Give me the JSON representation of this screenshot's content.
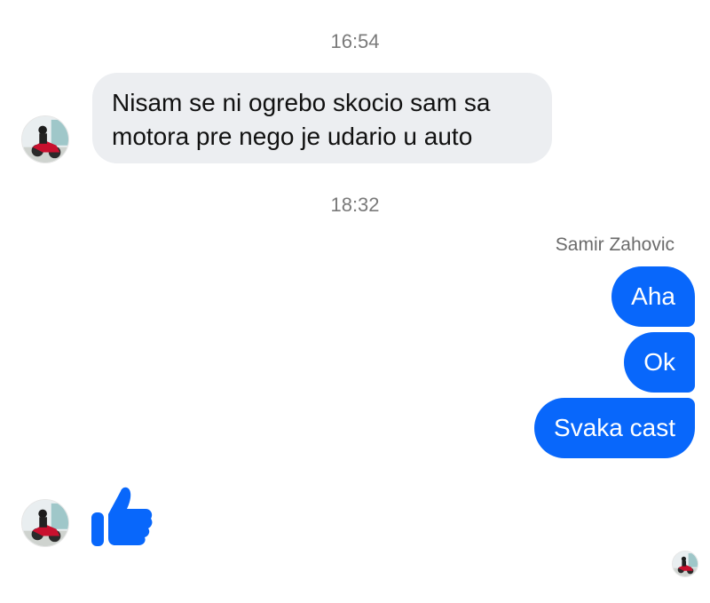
{
  "messages": {
    "time_1": "16:54",
    "incoming_1": "Nisam se ni ogrebo skocio sam sa motora pre nego je udario u auto",
    "time_2": "18:32",
    "sender_name": "Samir Zahovic",
    "outgoing_1": "Aha",
    "outgoing_2": "Ok",
    "outgoing_3": "Svaka cast"
  },
  "reaction": {
    "icon": "thumbs-up-icon"
  },
  "colors": {
    "accent": "#0867fb",
    "incoming_bubble": "#eceef1",
    "timestamp": "#7a7a7a"
  }
}
